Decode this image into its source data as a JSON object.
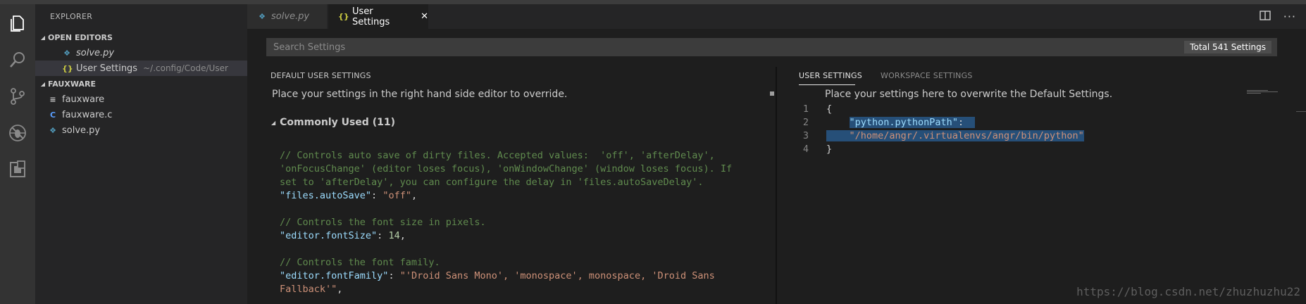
{
  "sidebar": {
    "title": "EXPLORER",
    "open_editors": {
      "label": "OPEN EDITORS",
      "items": [
        {
          "label": "solve.py",
          "icon": "python-file-icon"
        },
        {
          "label": "User Settings",
          "path": "~/.config/Code/User",
          "icon": "json-file-icon"
        }
      ]
    },
    "folder": {
      "label": "FAUXWARE",
      "items": [
        {
          "label": "fauxware",
          "icon": "text-file-icon"
        },
        {
          "label": "fauxware.c",
          "icon": "c-file-icon"
        },
        {
          "label": "solve.py",
          "icon": "python-file-icon"
        }
      ]
    }
  },
  "tabs": [
    {
      "label": "solve.py",
      "active": false
    },
    {
      "label": "User Settings",
      "active": true
    }
  ],
  "search": {
    "placeholder": "Search Settings",
    "count": "Total 541 Settings"
  },
  "left_editor": {
    "title": "DEFAULT USER SETTINGS",
    "info": "Place your settings in the right hand side editor to override.",
    "group": "Commonly Used (11)",
    "lines": [
      "// Controls auto save of dirty files. Accepted values:  'off', 'afterDelay',",
      "'onFocusChange' (editor loses focus), 'onWindowChange' (window loses focus). If",
      "set to 'afterDelay', you can configure the delay in 'files.autoSaveDelay'.",
      "\"files.autoSave\"",
      "\"off\"",
      "// Controls the font size in pixels.",
      "\"editor.fontSize\"",
      "14",
      "// Controls the font family.",
      "\"editor.fontFamily\"",
      "\"'Droid Sans Mono', 'monospace', monospace, 'Droid Sans",
      "Fallback'\""
    ]
  },
  "right_editor": {
    "tabs": [
      "USER SETTINGS",
      "WORKSPACE SETTINGS"
    ],
    "info": "Place your settings here to overwrite the Default Settings.",
    "line_numbers": [
      "1",
      "2",
      "3",
      "4"
    ],
    "open_brace": "{",
    "key": "\"python.pythonPath\"",
    "value": "\"/home/angr/.virtualenvs/angr/bin/python\"",
    "close_brace": "}"
  },
  "watermark": "https://blog.csdn.net/zhuzhuzhu22",
  "colors": {
    "comment": "#608b4e",
    "key": "#9cdcfe",
    "string": "#ce9178",
    "number": "#b5cea8",
    "selection": "#264f78"
  }
}
